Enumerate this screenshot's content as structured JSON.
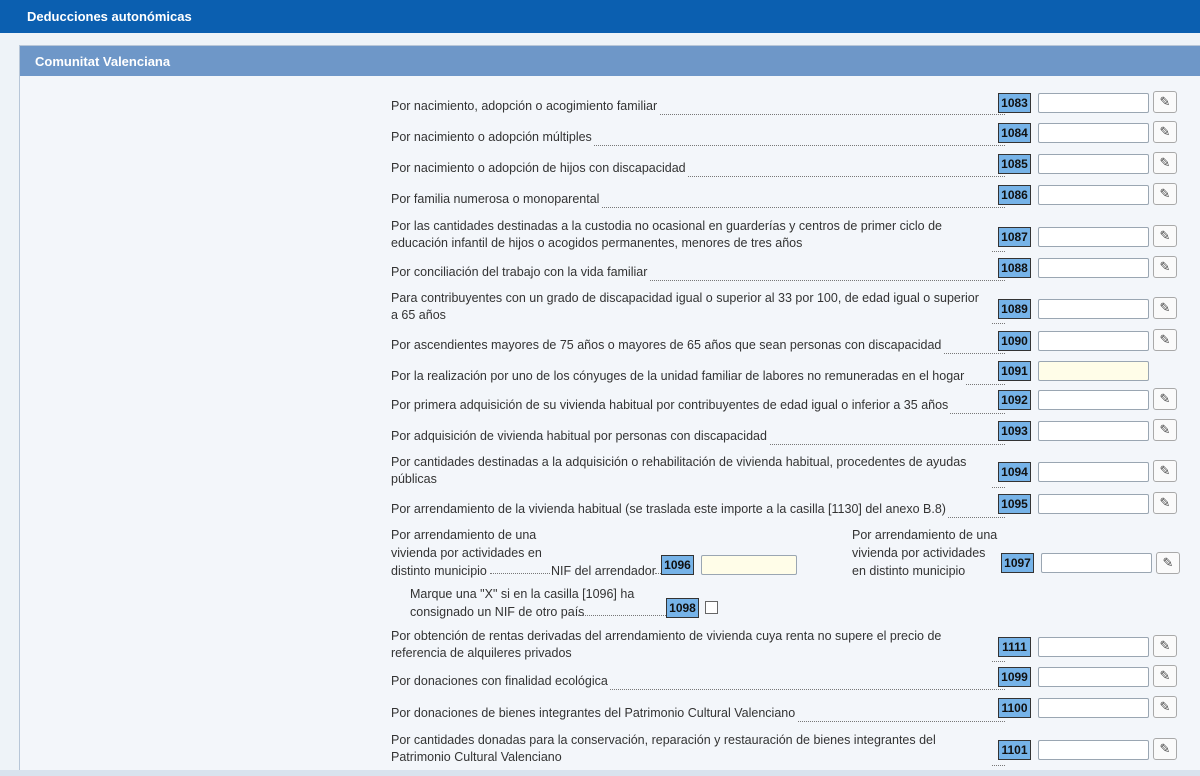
{
  "topbar": {
    "title": "Deducciones autonómicas"
  },
  "panel": {
    "title": "Comunitat Valenciana"
  },
  "edit_icon": "pencil-icon",
  "rows": [
    {
      "code": "1083",
      "label": "Por nacimiento, adopción o acogimiento familiar"
    },
    {
      "code": "1084",
      "label": "Por nacimiento o adopción múltiples"
    },
    {
      "code": "1085",
      "label": "Por nacimiento o adopción de hijos con discapacidad"
    },
    {
      "code": "1086",
      "label": "Por familia numerosa o monoparental"
    },
    {
      "code": "1087",
      "label": "Por las cantidades destinadas a la custodia no ocasional en guarderías y centros de primer ciclo de educación infantil de hijos o acogidos permanentes, menores de tres años"
    },
    {
      "code": "1088",
      "label": "Por conciliación del trabajo con la vida familiar"
    },
    {
      "code": "1089",
      "label": "Para contribuyentes con un grado de discapacidad igual o superior al 33 por 100, de edad igual o superior a 65 años"
    },
    {
      "code": "1090",
      "label": "Por ascendientes mayores de 75 años o mayores de 65 años que sean personas con discapacidad"
    },
    {
      "code": "1091",
      "label": "Por la realización por uno de los cónyuges de la unidad familiar de labores no remuneradas en el hogar"
    },
    {
      "code": "1092",
      "label": "Por primera adquisición de su vivienda habitual por contribuyentes de edad igual o inferior a 35 años"
    },
    {
      "code": "1093",
      "label": "Por adquisición de vivienda habitual por personas con discapacidad"
    },
    {
      "code": "1094",
      "label": "Por cantidades destinadas a la adquisición o rehabilitación de vivienda habitual, procedentes de ayudas públicas"
    },
    {
      "code": "1095",
      "label": "Por arrendamiento de la vivienda habitual (se traslada este importe a la casilla [1130] del anexo B.8)"
    },
    {
      "code": "1111",
      "label": "Por obtención de rentas derivadas del arrendamiento de vivienda cuya renta no supere el precio de referencia de alquileres privados"
    },
    {
      "code": "1099",
      "label": "Por donaciones con finalidad ecológica"
    },
    {
      "code": "1100",
      "label": "Por donaciones de bienes integrantes del Patrimonio Cultural Valenciano"
    },
    {
      "code": "1101",
      "label": "Por cantidades donadas para la conservación, reparación y restauración de bienes integrantes del Patrimonio Cultural Valenciano"
    }
  ],
  "arrendamiento": {
    "left_label": "Por arrendamiento de una vivienda por actividades en distinto municipio",
    "nif_label": "NIF del arrendador",
    "nif_code": "1096",
    "right_label": "Por arrendamiento de una vivienda por actividades en distinto municipio",
    "right_code": "1097",
    "check_label": "Marque una \"X\" si en la casilla [1096] ha consignado un NIF de otro país",
    "check_code": "1098"
  }
}
